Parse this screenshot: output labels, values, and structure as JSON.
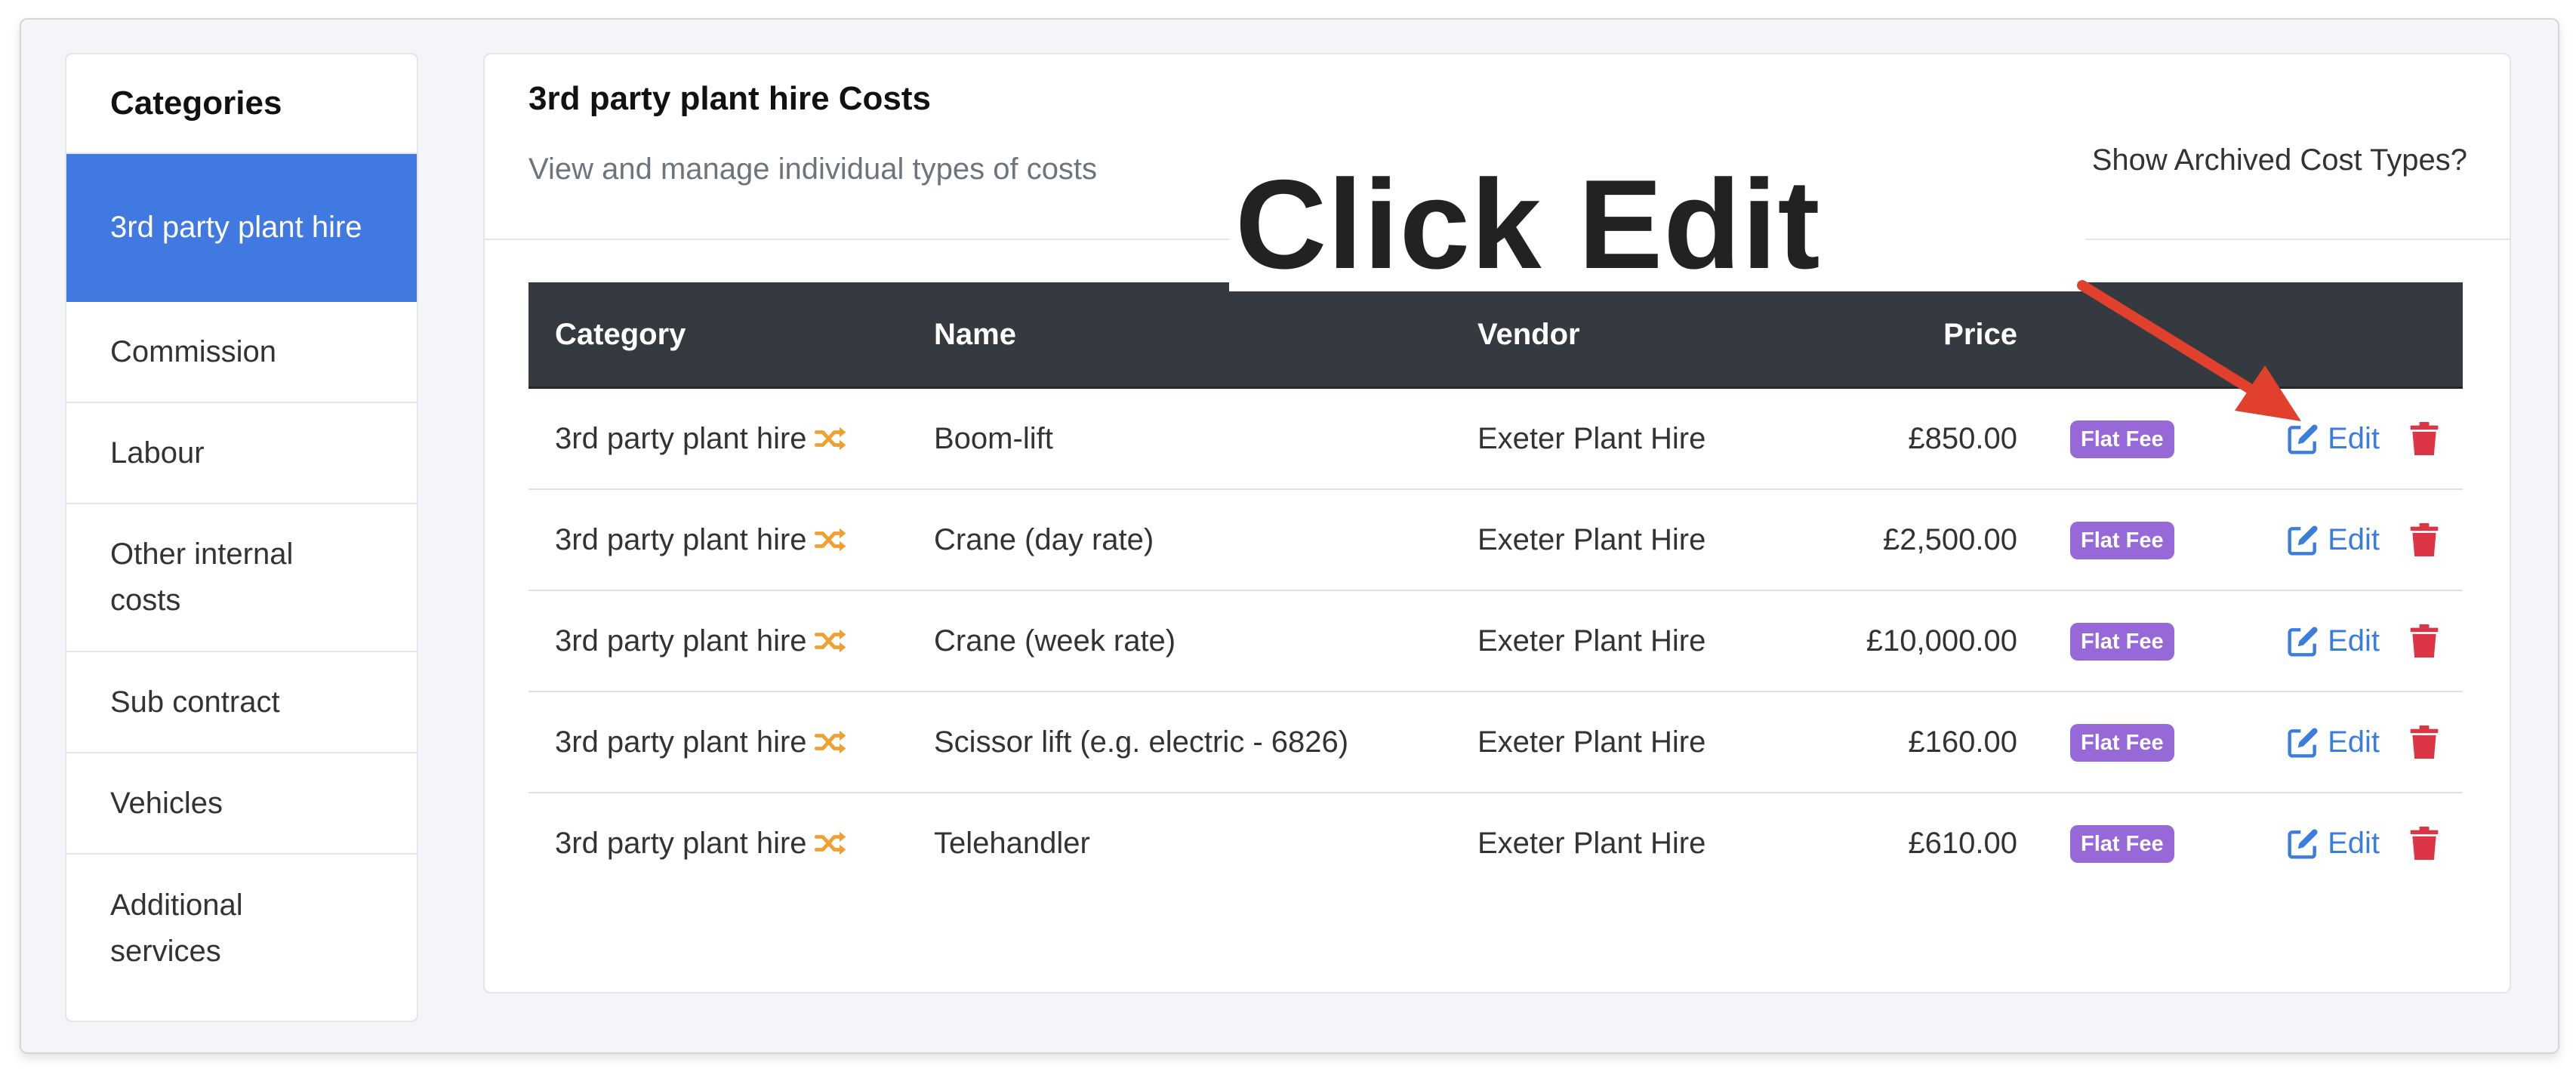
{
  "sidebar": {
    "title": "Categories",
    "items": [
      {
        "label": "3rd party plant hire",
        "active": true
      },
      {
        "label": "Commission",
        "active": false
      },
      {
        "label": "Labour",
        "active": false
      },
      {
        "label": "Other internal costs",
        "active": false
      },
      {
        "label": "Sub contract",
        "active": false
      },
      {
        "label": "Vehicles",
        "active": false
      },
      {
        "label": "Additional services",
        "active": false
      }
    ]
  },
  "main": {
    "title": "3rd party plant hire Costs",
    "subtitle": "View and manage individual types of costs",
    "archived_toggle": "Show Archived Cost Types?"
  },
  "table": {
    "columns": [
      "Category",
      "Name",
      "Vendor",
      "Price"
    ],
    "rows": [
      {
        "category": "3rd party plant hire",
        "name": "Boom-lift",
        "vendor": "Exeter Plant Hire",
        "price": "£850.00",
        "type": "Flat Fee",
        "edit": "Edit"
      },
      {
        "category": "3rd party plant hire",
        "name": "Crane (day rate)",
        "vendor": "Exeter Plant Hire",
        "price": "£2,500.00",
        "type": "Flat Fee",
        "edit": "Edit"
      },
      {
        "category": "3rd party plant hire",
        "name": "Crane (week rate)",
        "vendor": "Exeter Plant Hire",
        "price": "£10,000.00",
        "type": "Flat Fee",
        "edit": "Edit"
      },
      {
        "category": "3rd party plant hire",
        "name": "Scissor lift (e.g. electric - 6826)",
        "vendor": "Exeter Plant Hire",
        "price": "£160.00",
        "type": "Flat Fee",
        "edit": "Edit"
      },
      {
        "category": "3rd party plant hire",
        "name": "Telehandler",
        "vendor": "Exeter Plant Hire",
        "price": "£610.00",
        "type": "Flat Fee",
        "edit": "Edit"
      }
    ]
  },
  "annotation": {
    "callout_text": "Click Edit"
  },
  "colors": {
    "active_sidebar": "#4079e0",
    "header_bg": "#343a40",
    "badge": "#9668d8",
    "link": "#3b7ddd",
    "danger": "#dc3545",
    "shuffle_icon": "#f0a030",
    "arrow": "#e0402c"
  },
  "icons": {
    "category_marker": "shuffle-icon",
    "edit": "edit-icon",
    "delete": "trash-icon"
  }
}
